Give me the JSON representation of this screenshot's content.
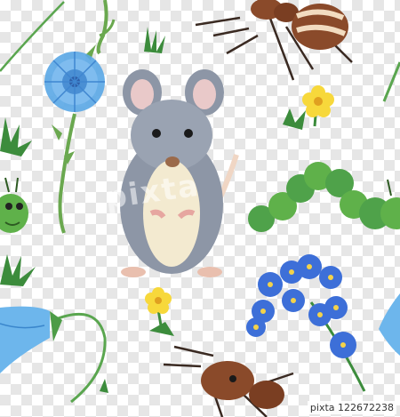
{
  "image": {
    "watermark_text": "pixta",
    "stock_id": "pixta 122672238"
  },
  "colors": {
    "mouse_fur": "#8d96a6",
    "mouse_belly": "#f3ead0",
    "chicory_blue": "#5aa7e6",
    "caterpillar_green": "#3f9a45",
    "buttercup_yellow": "#f7d83b",
    "ant_brown": "#8a4a2a",
    "bellflower_blue": "#6db6ec",
    "forget_me_not": "#3d6fd8",
    "grass_green": "#3c8c3c"
  },
  "icons": [
    "mouse",
    "chicory-flower",
    "ant",
    "caterpillar",
    "buttercup",
    "bellflower",
    "forget-me-not",
    "grass-tuft"
  ]
}
